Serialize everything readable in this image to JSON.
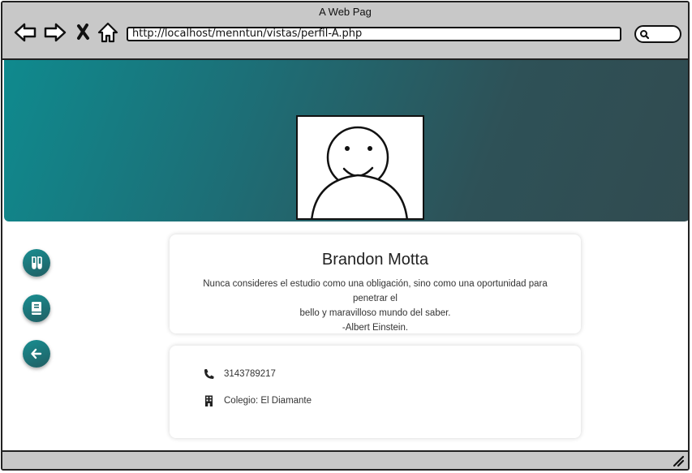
{
  "window": {
    "title": "A Web Pag"
  },
  "browser": {
    "url": "http://localhost/menntun/vistas/perfil-A.php",
    "nav_icons": [
      "back-arrow-icon",
      "forward-arrow-icon",
      "close-x-icon",
      "home-icon"
    ],
    "search_icon": "search-icon"
  },
  "hero": {
    "gradient_colors": [
      "#0f8a8e",
      "#314b50"
    ],
    "avatar_icon": "user-avatar-icon"
  },
  "sidebar": {
    "buttons": [
      {
        "icon": "flask-icon"
      },
      {
        "icon": "book-icon"
      },
      {
        "icon": "arrow-left-icon"
      }
    ],
    "accent": "#1a7f83"
  },
  "profile": {
    "name": "Brandon Motta",
    "quote_line1": "Nunca consideres el estudio como una obligación, sino como una oportunidad para penetrar el",
    "quote_line2": "bello y maravilloso mundo del saber.",
    "quote_author": "-Albert Einstein."
  },
  "info": {
    "phone": "3143789217",
    "school": "Colegio: El Diamante",
    "phone_icon": "phone-icon",
    "school_icon": "building-icon"
  }
}
